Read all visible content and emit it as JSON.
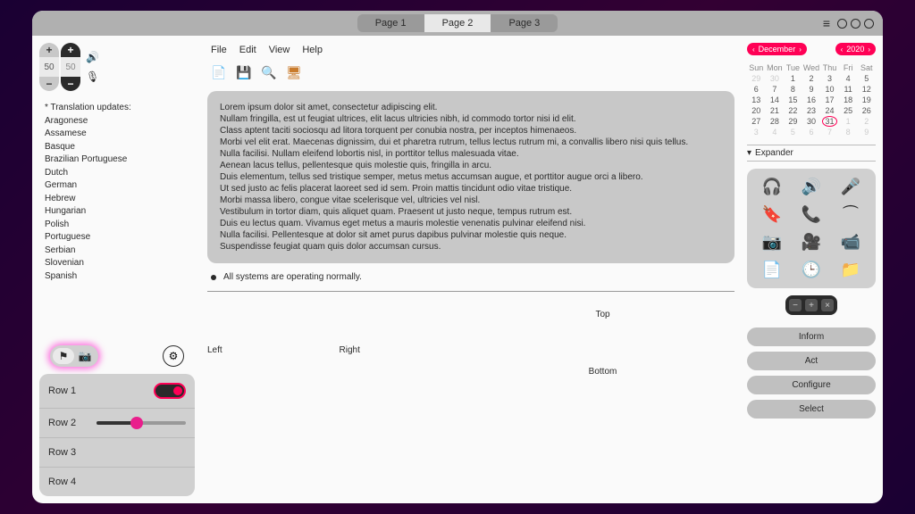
{
  "tabs": [
    "Page 1",
    "Page 2",
    "Page 3"
  ],
  "active_tab": 1,
  "spinner1": "50",
  "spinner2": "50",
  "translation_header": "* Translation updates:",
  "languages": [
    "Aragonese",
    "Assamese",
    "Basque",
    "Brazilian Portuguese",
    "Dutch",
    "German",
    "Hebrew",
    "Hungarian",
    "Polish",
    "Portuguese",
    "Serbian",
    "Slovenian",
    "Spanish"
  ],
  "rows": {
    "r1": "Row 1",
    "r2": "Row 2",
    "r3": "Row 3",
    "r4": "Row 4"
  },
  "menubar": {
    "file": "File",
    "edit": "Edit",
    "view": "View",
    "help": "Help"
  },
  "lorem": [
    "Lorem ipsum dolor sit amet, consectetur adipiscing elit.",
    "Nullam fringilla, est ut feugiat ultrices, elit lacus ultricies nibh, id commodo tortor nisi id elit.",
    "Class aptent taciti sociosqu ad litora torquent per conubia nostra, per inceptos himenaeos.",
    "Morbi vel elit erat. Maecenas dignissim, dui et pharetra rutrum, tellus lectus rutrum mi, a convallis libero nisi quis tellus.",
    "Nulla facilisi. Nullam eleifend lobortis nisl, in porttitor tellus malesuada vitae.",
    "Aenean lacus tellus, pellentesque quis molestie quis, fringilla in arcu.",
    "Duis elementum, tellus sed tristique semper, metus metus accumsan augue, et porttitor augue orci a libero.",
    "Ut sed justo ac felis placerat laoreet sed id sem. Proin mattis tincidunt odio vitae tristique.",
    "Morbi massa libero, congue vitae scelerisque vel, ultricies vel nisl.",
    "Vestibulum in tortor diam, quis aliquet quam. Praesent ut justo neque, tempus rutrum est.",
    "Duis eu lectus quam. Vivamus eget metus a mauris molestie venenatis pulvinar eleifend nisi.",
    "Nulla facilisi. Pellentesque at dolor sit amet purus dapibus pulvinar molestie quis neque.",
    "Suspendisse feugiat quam quis dolor accumsan cursus."
  ],
  "status_text": "All systems are operating normally.",
  "layout": {
    "top": "Top",
    "left": "Left",
    "right": "Right",
    "bottom": "Bottom"
  },
  "calendar": {
    "month": "December",
    "year": "2020",
    "days_of_week": [
      "Sun",
      "Mon",
      "Tue",
      "Wed",
      "Thu",
      "Fri",
      "Sat"
    ],
    "weeks": [
      [
        {
          "d": "29",
          "m": true
        },
        {
          "d": "30",
          "m": true
        },
        {
          "d": "1"
        },
        {
          "d": "2"
        },
        {
          "d": "3"
        },
        {
          "d": "4"
        },
        {
          "d": "5"
        }
      ],
      [
        {
          "d": "6"
        },
        {
          "d": "7"
        },
        {
          "d": "8"
        },
        {
          "d": "9"
        },
        {
          "d": "10"
        },
        {
          "d": "11"
        },
        {
          "d": "12"
        }
      ],
      [
        {
          "d": "13"
        },
        {
          "d": "14"
        },
        {
          "d": "15"
        },
        {
          "d": "16"
        },
        {
          "d": "17"
        },
        {
          "d": "18"
        },
        {
          "d": "19"
        }
      ],
      [
        {
          "d": "20"
        },
        {
          "d": "21"
        },
        {
          "d": "22"
        },
        {
          "d": "23"
        },
        {
          "d": "24"
        },
        {
          "d": "25"
        },
        {
          "d": "26"
        }
      ],
      [
        {
          "d": "27"
        },
        {
          "d": "28"
        },
        {
          "d": "29"
        },
        {
          "d": "30"
        },
        {
          "d": "31",
          "t": true
        },
        {
          "d": "1",
          "m": true
        },
        {
          "d": "2",
          "m": true
        }
      ],
      [
        {
          "d": "3",
          "m": true
        },
        {
          "d": "4",
          "m": true
        },
        {
          "d": "5",
          "m": true
        },
        {
          "d": "6",
          "m": true
        },
        {
          "d": "7",
          "m": true
        },
        {
          "d": "8",
          "m": true
        },
        {
          "d": "9",
          "m": true
        }
      ]
    ]
  },
  "expander_label": "Expander",
  "icon_names": [
    "headphones-icon",
    "volume-icon",
    "microphone-icon",
    "bookmark-add-icon",
    "phone-icon",
    "hangup-icon",
    "camera-icon",
    "movie-icon",
    "video-icon",
    "document-add-icon",
    "clock-icon",
    "folder-icon"
  ],
  "action_buttons": [
    "Inform",
    "Act",
    "Configure",
    "Select"
  ],
  "btn_bar": [
    "−",
    "+",
    "×"
  ],
  "colors": {
    "accent": "#ff0055",
    "magenta": "#e91e8c"
  }
}
